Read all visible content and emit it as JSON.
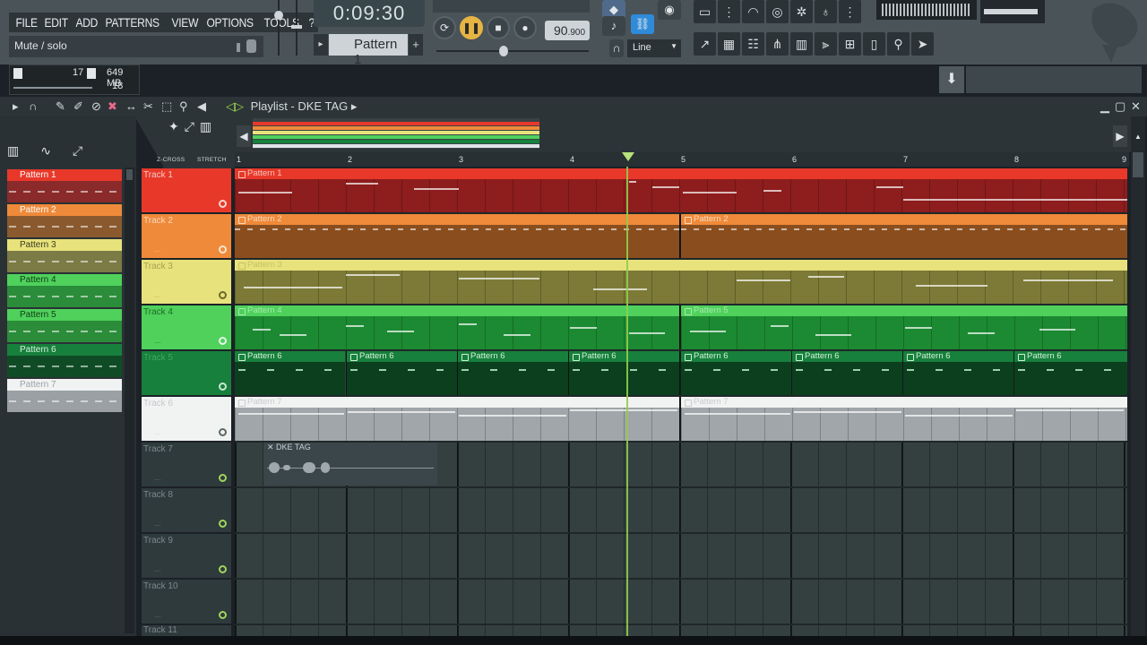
{
  "menu": {
    "items": [
      "FILE",
      "EDIT",
      "ADD",
      "PATTERNS",
      "VIEW",
      "OPTIONS",
      "TOOLS",
      "?"
    ]
  },
  "hint_bar": {
    "text": "Mute / solo"
  },
  "transport": {
    "time": "0:09:30",
    "pattern_label": "Pattern 1",
    "tempo_main": "90",
    "tempo_frac": ".900",
    "play_symbol": "❚❚",
    "stop_symbol": "■",
    "record_symbol": "●",
    "loop_symbol": "⟳",
    "pattern_prev": "▸",
    "pattern_add": "+",
    "snap_mode": "Line",
    "snap_arrow": "▼"
  },
  "perf": {
    "cpu": "17",
    "ram": "649 MB",
    "voices": "18"
  },
  "playlist": {
    "title": "Playlist - DKE TAG",
    "arrow": "▸",
    "zcross_label": "Z-CROSS",
    "stretch_label": "STRETCH",
    "ruler_marks": [
      "1",
      "2",
      "3",
      "4",
      "5",
      "6",
      "7",
      "8",
      "9"
    ],
    "tracks": [
      {
        "name": "Track 1",
        "color": "#e8382a"
      },
      {
        "name": "Track 2",
        "color": "#ef8a3a"
      },
      {
        "name": "Track 3",
        "color": "#e8e27c"
      },
      {
        "name": "Track 4",
        "color": "#4fd15c"
      },
      {
        "name": "Track 5",
        "color": "#17803c"
      },
      {
        "name": "Track 6",
        "color": "#f1f2f2"
      },
      {
        "name": "Track 7",
        "color": ""
      },
      {
        "name": "Track 8",
        "color": ""
      },
      {
        "name": "Track 9",
        "color": ""
      },
      {
        "name": "Track 10",
        "color": ""
      },
      {
        "name": "Track 11",
        "color": ""
      }
    ],
    "track_dots": "...",
    "audio_clip": "DKE TAG"
  },
  "patterns": [
    {
      "name": "Pattern 1",
      "color": "#e8382a"
    },
    {
      "name": "Pattern 2",
      "color": "#ef8a3a"
    },
    {
      "name": "Pattern 3",
      "color": "#e8e27c"
    },
    {
      "name": "Pattern 4",
      "color": "#4fd15c"
    },
    {
      "name": "Pattern 5",
      "color": "#4fd15c"
    },
    {
      "name": "Pattern 6",
      "color": "#17803c"
    },
    {
      "name": "Pattern 7",
      "color": "#f1f2f2"
    }
  ],
  "clips": {
    "track1": [
      "Pattern 1"
    ],
    "track2": [
      "Pattern 2",
      "Pattern 2"
    ],
    "track3": [
      "Pattern 3"
    ],
    "track4": [
      "Pattern 4",
      "Pattern 5"
    ],
    "track5": [
      "Pattern 6",
      "Pattern 6",
      "Pattern 6",
      "Pattern 6",
      "Pattern 6",
      "Pattern 6",
      "Pattern 6",
      "Pattern 6"
    ],
    "track6": [
      "Pattern 7",
      "Pattern 7"
    ]
  },
  "icons": {
    "menu_window": "☰",
    "close": "✕",
    "maximize": "▢",
    "minimize": "▁",
    "download": "⬇",
    "overview_left": "◀",
    "overview_right": "▶",
    "scroll_up": "▲"
  }
}
